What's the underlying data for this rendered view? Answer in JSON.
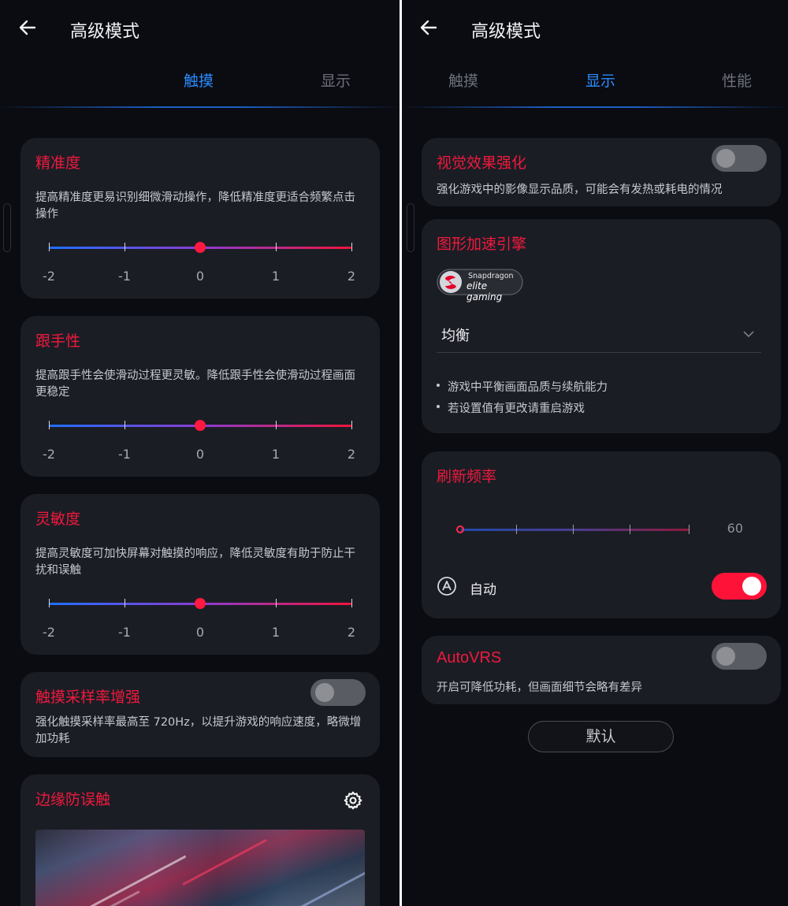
{
  "left": {
    "header": {
      "title": "高级模式"
    },
    "tabs": [
      {
        "label": "触摸",
        "active": true
      },
      {
        "label": "显示",
        "active": false
      }
    ],
    "precision": {
      "title": "精准度",
      "description": "提高精准度更易识别细微滑动操作，降低精准度更适合频繁点击操作",
      "labels": [
        "-2",
        "-1",
        "0",
        "1",
        "2"
      ],
      "value": 0
    },
    "tracking": {
      "title": "跟手性",
      "description": "提高跟手性会使滑动过程更灵敏。降低跟手性会使滑动过程画面更稳定",
      "labels": [
        "-2",
        "-1",
        "0",
        "1",
        "2"
      ],
      "value": 0
    },
    "sensitivity": {
      "title": "灵敏度",
      "description": "提高灵敏度可加快屏幕对触摸的响应，降低灵敏度有助于防止干扰和误触",
      "labels": [
        "-2",
        "-1",
        "0",
        "1",
        "2"
      ],
      "value": 0
    },
    "sampling": {
      "title": "触摸采样率增强",
      "description": "强化触摸采样率最高至 720Hz，以提升游戏的响应速度，略微增加功耗",
      "enabled": false
    },
    "edge": {
      "title": "边缘防误触",
      "icon": "gear-icon"
    }
  },
  "right": {
    "header": {
      "title": "高级模式"
    },
    "tabs": [
      {
        "label": "触摸",
        "active": false
      },
      {
        "label": "显示",
        "active": true
      },
      {
        "label": "性能",
        "active": false
      }
    ],
    "visual": {
      "title": "视觉效果强化",
      "description": "强化游戏中的影像显示品质，可能会有发热或耗电的情况",
      "enabled": false
    },
    "graphics": {
      "title": "图形加速引擎",
      "logo_line1": "Snapdragon",
      "logo_line2": "elite gaming",
      "selected": "均衡",
      "bullets": [
        "游戏中平衡画面品质与续航能力",
        "若设置值有更改请重启游戏"
      ]
    },
    "refresh": {
      "title": "刷新频率",
      "value": "60",
      "slider_position": 0,
      "auto_label": "自动",
      "auto_enabled": true
    },
    "autovrs": {
      "title": "AutoVRS",
      "description": "开启可降低功耗，但画面细节会略有差异",
      "enabled": false
    },
    "default_label": "默认"
  },
  "colors": {
    "accent_red": "#f0193c",
    "tab_active_blue": "#2a8cff",
    "card_bg": "#1b1d25",
    "page_bg": "#0a0c12"
  }
}
